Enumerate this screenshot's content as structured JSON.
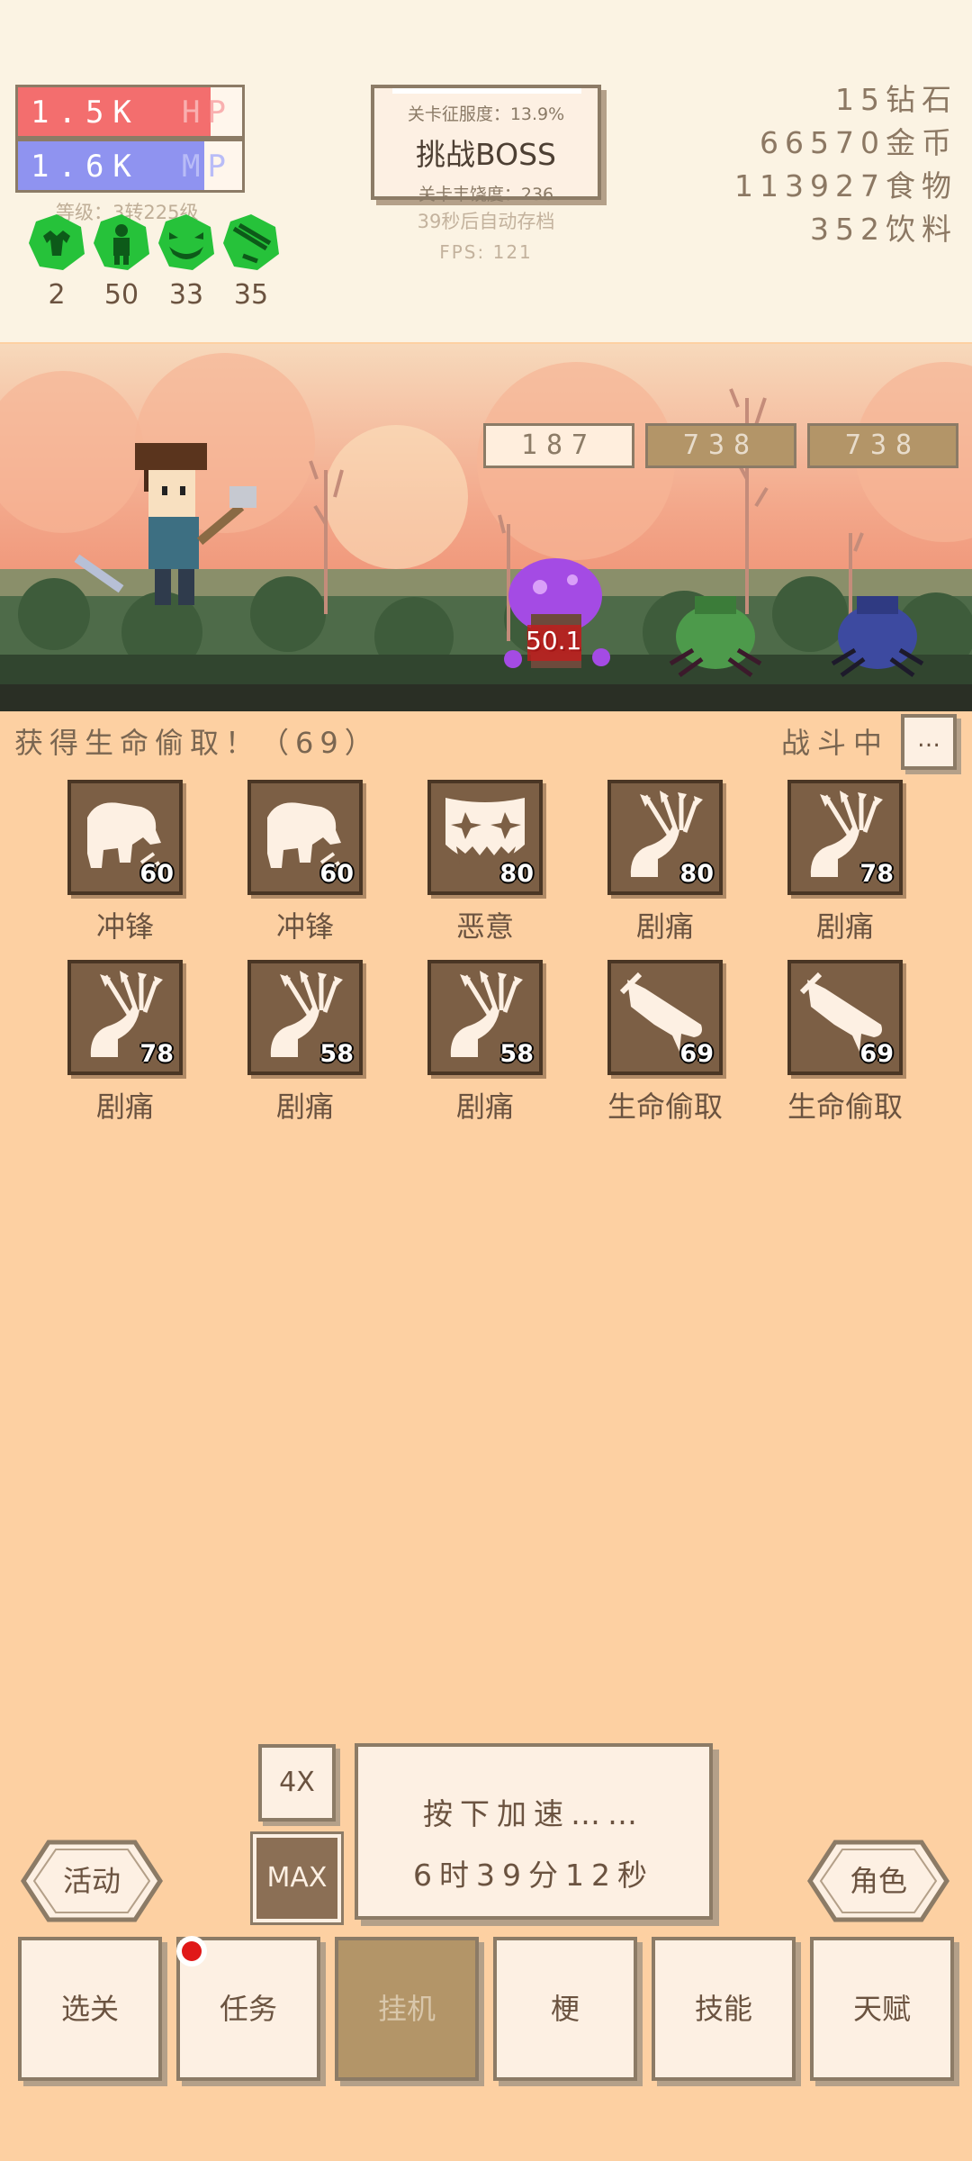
{
  "player": {
    "hp_value": "1.5K",
    "hp_tag": "HP",
    "hp_ratio": 0.86,
    "mp_value": "1.6K",
    "mp_tag": "MP",
    "mp_ratio": 0.83,
    "level_text": "等级：3转225级"
  },
  "buffs": [
    {
      "icon": "muscle-icon",
      "count": "2"
    },
    {
      "icon": "armored-figure-icon",
      "count": "50"
    },
    {
      "icon": "grinning-face-icon",
      "count": "33"
    },
    {
      "icon": "arrow-hit-icon",
      "count": "35"
    }
  ],
  "boss_panel": {
    "progress_text": "关卡征服度：13.9%",
    "challenge_label": "挑战BOSS",
    "richness_text": "关卡丰饶度：236"
  },
  "autosave_text": "39秒后自动存档",
  "fps_text": "FPS: 121",
  "resources": [
    {
      "text": "15钻石"
    },
    {
      "text": "66570金币"
    },
    {
      "text": "113927食物"
    },
    {
      "text": "352饮料"
    }
  ],
  "enemies": [
    {
      "hp": "187",
      "name": "purple-mushroom",
      "active": true
    },
    {
      "hp": "738",
      "name": "green-beetle",
      "active": false
    },
    {
      "hp": "738",
      "name": "blue-beetle",
      "active": false
    }
  ],
  "damage_popup": "50.1",
  "log_text": "获得生命偷取！（69）",
  "battle_status": "战斗中",
  "more_label": "…",
  "skills": [
    {
      "name": "冲锋",
      "level": "60",
      "icon": "charge-icon"
    },
    {
      "name": "冲锋",
      "level": "60",
      "icon": "charge-icon"
    },
    {
      "name": "恶意",
      "level": "80",
      "icon": "malice-icon"
    },
    {
      "name": "剧痛",
      "level": "80",
      "icon": "agony-icon"
    },
    {
      "name": "剧痛",
      "level": "78",
      "icon": "agony-icon"
    },
    {
      "name": "剧痛",
      "level": "78",
      "icon": "agony-icon"
    },
    {
      "name": "剧痛",
      "level": "58",
      "icon": "agony-icon"
    },
    {
      "name": "剧痛",
      "level": "58",
      "icon": "agony-icon"
    },
    {
      "name": "生命偷取",
      "level": "69",
      "icon": "lifesteal-icon"
    },
    {
      "name": "生命偷取",
      "level": "69",
      "icon": "lifesteal-icon"
    }
  ],
  "speed": {
    "btn_4x": "4X",
    "btn_max": "MAX",
    "line1": "按下加速……",
    "line2": "6时39分12秒"
  },
  "side_buttons": {
    "left": "活动",
    "right": "角色"
  },
  "nav": [
    {
      "label": "选关",
      "active": false
    },
    {
      "label": "任务",
      "active": false,
      "badge": true
    },
    {
      "label": "挂机",
      "active": true
    },
    {
      "label": "梗",
      "active": false
    },
    {
      "label": "技能",
      "active": false
    },
    {
      "label": "天赋",
      "active": false
    }
  ],
  "colors": {
    "background": "#fdd0a2",
    "panel": "#fdf0e3",
    "border": "#8c7b66",
    "hp": "#f36e6e",
    "mp": "#8f93f0",
    "active_nav": "#b39568",
    "badge": "#e01818"
  }
}
